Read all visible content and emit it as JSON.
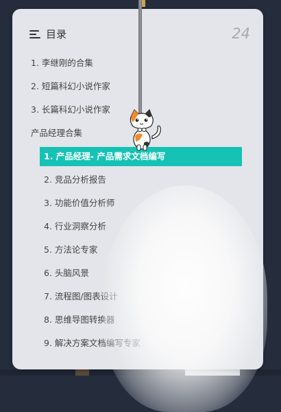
{
  "toc": {
    "title": "目录",
    "count": "24",
    "items": [
      "1. 李继刚的合集",
      "2. 短篇科幻小说作家",
      "3. 长篇科幻小说作家"
    ],
    "section": "产品经理合集",
    "sub_items": [
      "1. 产品经理- 产品需求文档编写",
      "2. 竞品分析报告",
      "3. 功能价值分析师",
      "4. 行业洞察分析",
      "5. 方法论专家",
      "6. 头脑风景",
      "7. 流程图/图表设计",
      "8. 思维导图转换器",
      "9. 解决方案文档编写专家"
    ]
  },
  "colors": {
    "accent": "#15c2b4",
    "panel": "#e3e5ea",
    "background": "#252d3d"
  },
  "icons": [
    "menu-icon",
    "cat-mascot-icon"
  ]
}
